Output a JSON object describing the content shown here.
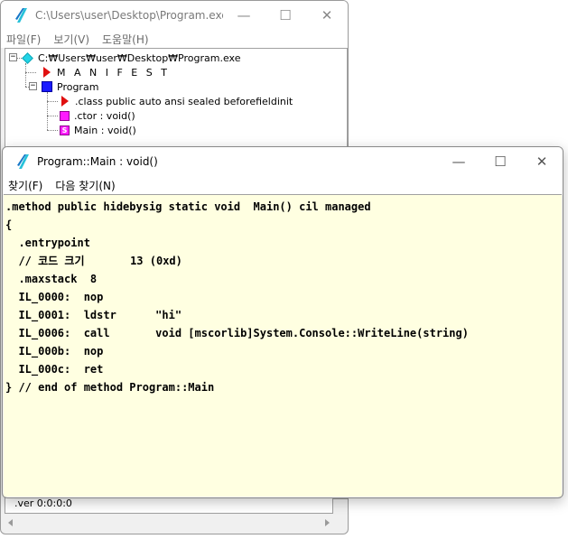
{
  "back_window": {
    "title": "C:\\Users\\user\\Desktop\\Program.exe -...",
    "menu": [
      "파일(F)",
      "보기(V)",
      "도움말(H)"
    ],
    "tree": {
      "root": "C:₩Users₩user₩Desktop₩Program.exe",
      "manifest": "M A N I F E S T",
      "program": "Program",
      "class_decl": ".class public auto ansi sealed beforefieldinit",
      "ctor": ".ctor : void()",
      "main": "Main : void()"
    },
    "ver_text": ".ver 0:0:0:0"
  },
  "front_window": {
    "title": "Program::Main : void()",
    "menu": [
      "찾기(F)",
      "다음 찾기(N)"
    ],
    "code_lines": [
      ".method public hidebysig static void  Main() cil managed",
      "{",
      "  .entrypoint",
      "  // 코드 크기       13 (0xd)",
      "  .maxstack  8",
      "  IL_0000:  nop",
      "  IL_0001:  ldstr      \"hi\"",
      "  IL_0006:  call       void [mscorlib]System.Console::WriteLine(string)",
      "  IL_000b:  nop",
      "  IL_000c:  ret",
      "} // end of method Program::Main"
    ]
  },
  "window_controls": {
    "minimize": "—",
    "maximize": "☐",
    "close": "✕"
  },
  "colors": {
    "code_background": "#ffffe1",
    "manifest_icon": "#e01010",
    "class_icon": "#1a1aff",
    "method_icon": "#ff1aff",
    "root_icon": "#22d3e6"
  }
}
